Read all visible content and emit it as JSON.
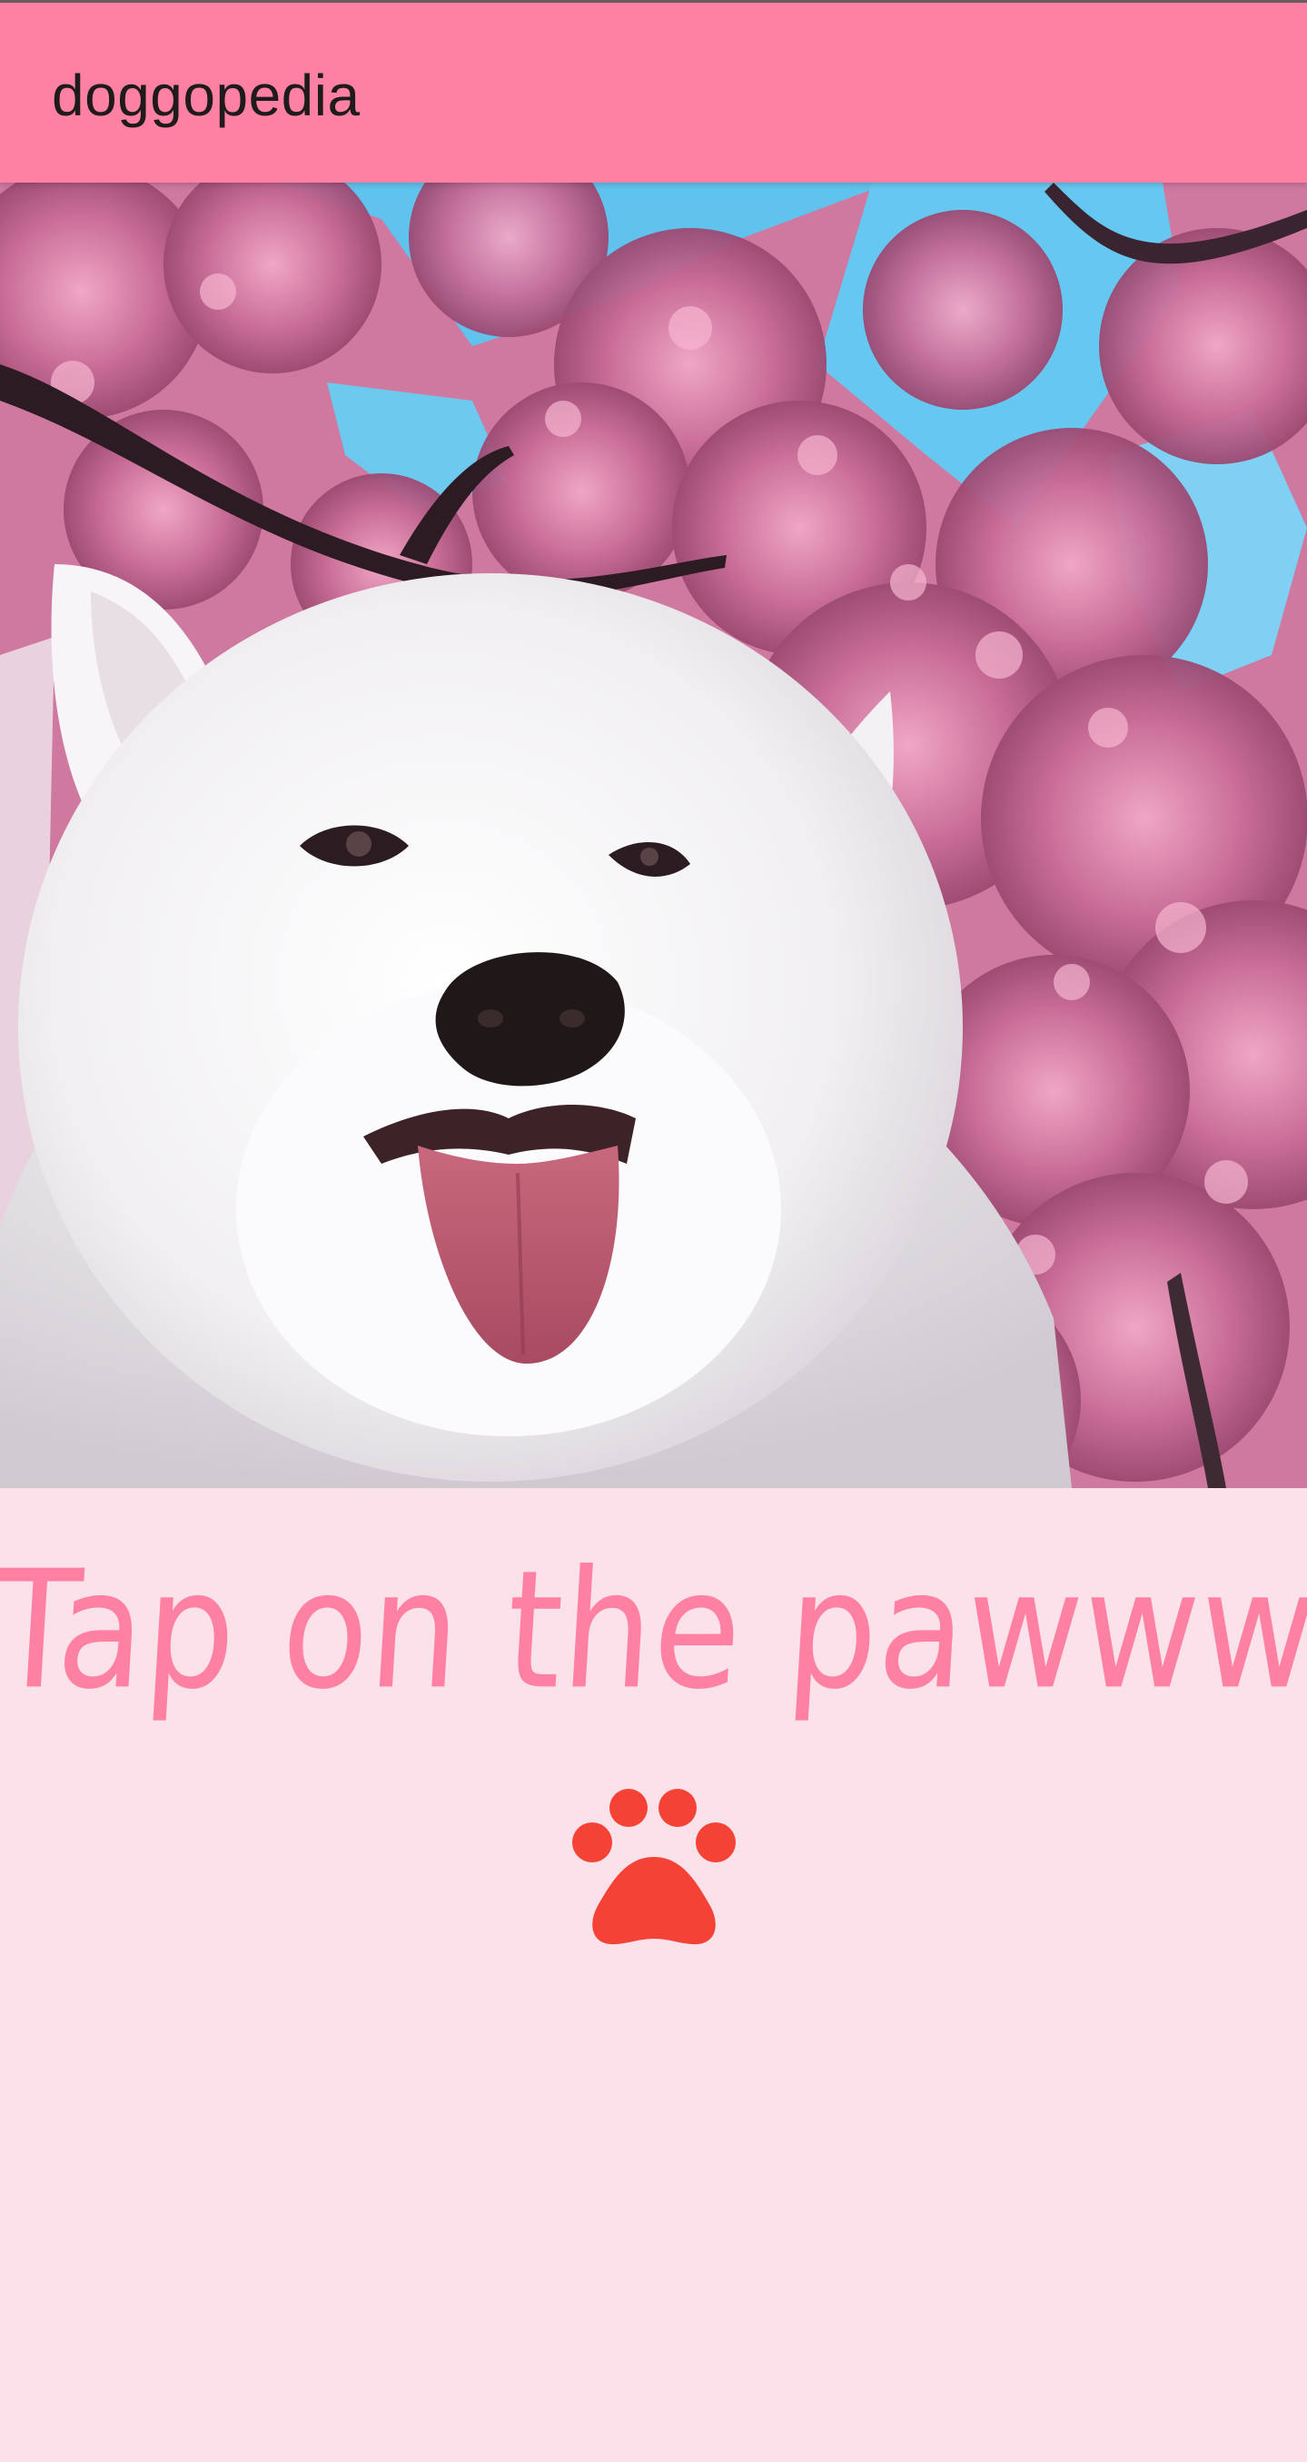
{
  "app_bar": {
    "title": "doggopedia",
    "background": "#fe81a3"
  },
  "hero": {
    "image_subject": "samoyed-dog-under-cherry-blossoms"
  },
  "main": {
    "prompt_text": "Tap on the pawww!",
    "prompt_color": "#fe81a3",
    "paw_icon": "paw-icon",
    "paw_color": "#f44336",
    "background": "#fbe1e9"
  }
}
